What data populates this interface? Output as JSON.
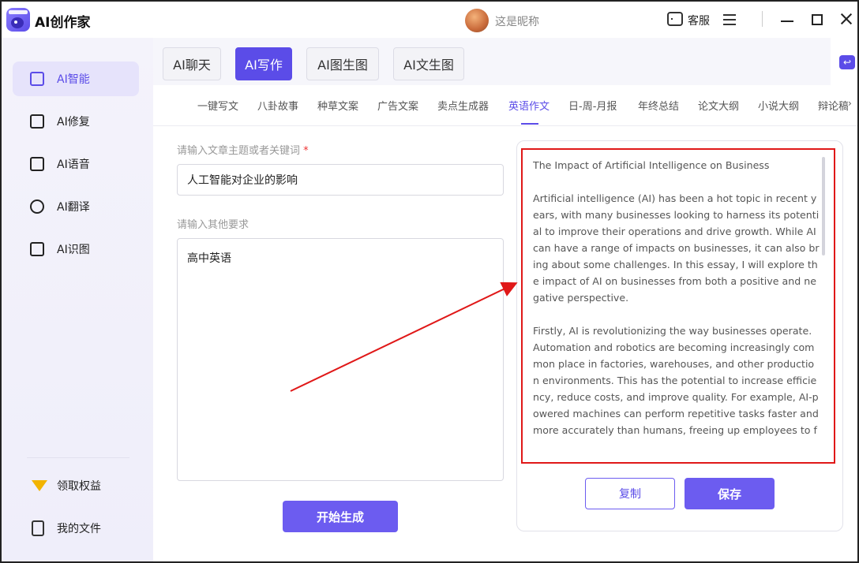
{
  "app": {
    "title": "AI创作家",
    "nickname": "这是昵称",
    "service_label": "客服"
  },
  "sidebar": {
    "items": [
      {
        "label": "AI智能",
        "icon": "ai-smart-icon",
        "active": true
      },
      {
        "label": "AI修复",
        "icon": "repair-icon",
        "active": false
      },
      {
        "label": "AI语音",
        "icon": "voice-icon",
        "active": false
      },
      {
        "label": "AI翻译",
        "icon": "translate-icon",
        "active": false
      },
      {
        "label": "AI识图",
        "icon": "image-recognize-icon",
        "active": false
      }
    ],
    "bottom": [
      {
        "label": "领取权益",
        "icon": "vip-icon"
      },
      {
        "label": "我的文件",
        "icon": "file-icon"
      }
    ]
  },
  "tabs": [
    {
      "label": "AI聊天",
      "active": false
    },
    {
      "label": "AI写作",
      "active": true
    },
    {
      "label": "AI图生图",
      "active": false
    },
    {
      "label": "AI文生图",
      "active": false
    }
  ],
  "subtabs": [
    {
      "label": "一键写文",
      "active": false
    },
    {
      "label": "八卦故事",
      "active": false
    },
    {
      "label": "种草文案",
      "active": false
    },
    {
      "label": "广告文案",
      "active": false
    },
    {
      "label": "卖点生成器",
      "active": false
    },
    {
      "label": "英语作文",
      "active": true
    },
    {
      "label": "日-周-月报",
      "active": false
    },
    {
      "label": "年终总结",
      "active": false
    },
    {
      "label": "论文大纲",
      "active": false
    },
    {
      "label": "小说大纲",
      "active": false
    },
    {
      "label": "辩论稿",
      "active": false
    }
  ],
  "form": {
    "topic_label": "请输入文章主题或者关键词",
    "topic_required": "*",
    "topic_value": "人工智能对企业的影响",
    "other_label": "请输入其他要求",
    "other_value": "高中英语",
    "generate_label": "开始生成"
  },
  "result": {
    "paragraphs": [
      "The Impact of Artificial Intelligence on Business",
      "Artificial intelligence (AI) has been a hot topic in recent years, with many businesses looking to harness its potential to improve their operations and drive growth. While AI can have a range of impacts on businesses, it can also bring about some challenges. In this essay, I will explore the impact of AI on businesses from both a positive and negative perspective.",
      "Firstly, AI is revolutionizing the way businesses operate. Automation and robotics are becoming increasingly common place in factories, warehouses, and other production environments. This has the potential to increase efficiency, reduce costs, and improve quality. For example, AI-powered machines can perform repetitive tasks faster and more accurately than humans, freeing up employees to focus on more valuable tasks."
    ],
    "copy_label": "复制",
    "save_label": "保存"
  },
  "colors": {
    "accent": "#5b4ce8",
    "annotation": "#e01818"
  }
}
